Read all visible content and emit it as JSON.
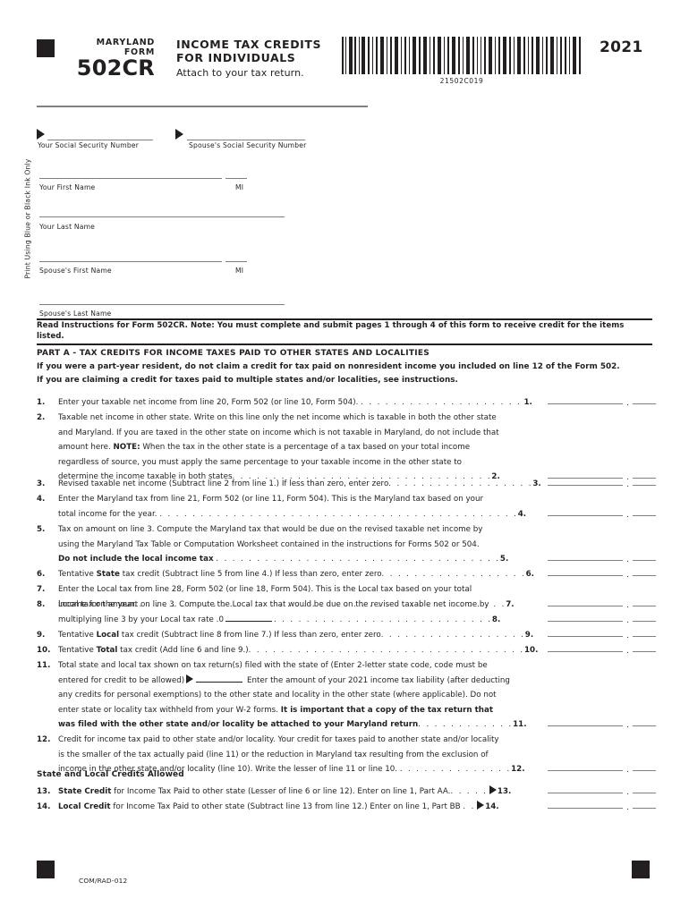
{
  "header": {
    "form_label_line1": "MARYLAND",
    "form_label_line2": "FORM",
    "form_number": "502CR",
    "title_line1": "INCOME TAX CREDITS",
    "title_line2": "FOR INDIVIDUALS",
    "subtitle": "Attach to your tax return.",
    "barcode_number": "21502C019",
    "year": "2021"
  },
  "sidebar": {
    "ink_note": "Print Using Blue or Black Ink Only"
  },
  "taxpayer_fields": [
    {
      "label": "Your Social Security Number",
      "value": ""
    },
    {
      "label": "Spouse's Social Security Number",
      "value": ""
    },
    {
      "label": "Your First Name",
      "value": ""
    },
    {
      "label": "MI",
      "value": ""
    },
    {
      "label": "Your Last Name",
      "value": ""
    },
    {
      "label": "Spouse's First Name",
      "value": ""
    },
    {
      "label": "MI",
      "value": ""
    },
    {
      "label": "Spouse's Last Name",
      "value": ""
    }
  ],
  "instructions": {
    "read_instructions": "Read Instructions for Form 502CR.  Note: You must complete and submit pages 1 through 4 of this form to receive credit for the items listed.",
    "part_heading": "PART A - TAX CREDITS FOR INCOME TAXES PAID TO OTHER STATES AND LOCALITIES",
    "note_a": "If you were a part-year resident, do not claim a credit for tax paid on nonresident income you included on line 12 of the Form 502.",
    "note_b": "If you are claiming a credit for taxes paid to multiple states and/or localities, see instructions."
  },
  "lines": {
    "l1": {
      "num": "1.",
      "text": "Enter your taxable net income from line 20, Form 502 (or line 10, Form 504).",
      "leader": ". . . . . . . . . . . . . . . . . . . .",
      "end": "1.",
      "value_dollars": "",
      "value_cents": ""
    },
    "l2": {
      "num": "2.",
      "t1": "Taxable net income in other state. Write on this line only the net income which is taxable in both the other state",
      "t2": "and Maryland. If you are taxed in the other state on income which is not taxable in Maryland, do not include that",
      "t3a": "amount here.  ",
      "t3b": "NOTE:",
      "t3c": " When the tax in the other state is a percentage of a tax based on your total income",
      "t4": "regardless of source, you must apply the same percentage to your taxable income in the other state to",
      "t5": "determine the income taxable in both states",
      "leader": ". . . . . . . . . . . . . . . . . . . . . . . . . . . . . . . .",
      "end": "2.",
      "value_dollars": "",
      "value_cents": ""
    },
    "l3": {
      "num": "3.",
      "text": "Revised taxable net income (Subtract line 2 from line 1.) If less than zero, enter zero",
      "leader": ". . . . . . . . . . . . . . . . . .",
      "end": "3.",
      "value_dollars": "",
      "value_cents": ""
    },
    "l4": {
      "num": "4.",
      "t1": "Enter the Maryland tax from line 21, Form 502 (or line 11, Form 504). This is the Maryland tax based on your",
      "t2": "total income for the year.",
      "leader": ". . . . . . . . . . . . . . . . . . . . . . . . . . . . . . . . . . . . . . . . . . . .",
      "end": "4.",
      "value_dollars": "",
      "value_cents": ""
    },
    "l5": {
      "num": "5.",
      "t1": "Tax on amount on line 3. Compute the Maryland tax that would be due on the revised taxable net income by",
      "t2": "using the Maryland Tax Table or Computation Worksheet contained in the instructions for Forms 502 or 504.",
      "t3": "Do not include the local income tax",
      "leader": ". . . . . . . . . . . . . . . . . . . . . . . . . . . . . . . . . . .",
      "end": "5.",
      "value_dollars": "",
      "value_cents": ""
    },
    "l6": {
      "num": "6.",
      "t1": "Tentative ",
      "t2": "State",
      "t3": " tax credit (Subtract line 5 from line 4.) If less than zero, enter zero",
      "leader": ". . . . . . . . . . . . . . . . . .",
      "end": "6.",
      "value_dollars": "",
      "value_cents": ""
    },
    "l7": {
      "num": "7.",
      "t1": "Enter the Local tax from line 28, Form 502 (or line 18, Form 504). This is the Local tax based on your total",
      "t2": "income for the year.",
      "leader": ". . . . . . . . . . . . . . . . . . . . . . . . . . . . . . . . . . . . . . . . . . . . .",
      "end": "7.",
      "value_dollars": "",
      "value_cents": ""
    },
    "l8": {
      "num": "8.",
      "t1": "Local tax on amount on line 3. Compute the Local tax that would be due on the revised taxable net income by",
      "t2": "multiplying line 3 by your Local tax rate",
      "rate_prefix": ".0",
      "rate_value": "",
      "leader": ". . . . . . . . . . . . . . . . . . . . . . . . . . .",
      "end": "8.",
      "value_dollars": "",
      "value_cents": ""
    },
    "l9": {
      "num": "9.",
      "t1": "Tentative ",
      "t2": "Local",
      "t3": " tax credit (Subtract line 8 from line 7.) If less than zero, enter zero",
      "leader": ". . . . . . . . . . . . . . . . . .",
      "end": "9.",
      "value_dollars": "",
      "value_cents": ""
    },
    "l10": {
      "num": "10.",
      "t1": "Tentative ",
      "t2": "Total",
      "t3": " tax credit (Add line 6 and line 9.)",
      "leader": ". . . . . . . . . . . . . . . . . . . . . . . . . . . . . . . . . .",
      "end": "10.",
      "value_dollars": "",
      "value_cents": ""
    },
    "l11": {
      "num": "11.",
      "t1": "Total state and local tax shown on tax return(s) filed with the state of (Enter 2-letter state code, code must be",
      "t2": "entered for credit to be allowed)",
      "state_code": "",
      "t3": "Enter the amount of your 2021 income tax liability (after deducting",
      "t4": "any credits for personal exemptions) to the other state and locality in the other state (where applicable). Do not",
      "t5a": "enter state or locality tax withheld from your W-2 forms. ",
      "t5b": "It is important that a copy of the tax return that",
      "t6": "was filed with the other state and/or locality be attached to your Maryland return",
      "leader": ". . . . . . . . . . . .",
      "end": "11.",
      "value_dollars": "",
      "value_cents": ""
    },
    "l12": {
      "num": "12.",
      "t1": "Credit for income tax paid to other state and/or locality. Your credit for taxes paid to another state and/or locality",
      "t2": "is the smaller of the tax actually paid (line 11) or the reduction in Maryland tax resulting from the exclusion of",
      "t3": "income in the other state and/or locality (line 10). Write the lesser of line 11 or line 10.",
      "leader": ". . . . . . . . . . . . . .",
      "end": "12.",
      "value_dollars": "",
      "value_cents": ""
    },
    "subhead": "State and Local Credits Allowed",
    "l13": {
      "num": "13.",
      "t1": "State Credit",
      "t2": " for Income Tax Paid to other state (Lesser of line 6 or line 12). Enter on line 1, Part AA.",
      "leader": ". . . . .",
      "end": "13.",
      "value_dollars": "",
      "value_cents": ""
    },
    "l14": {
      "num": "14.",
      "t1": "Local Credit",
      "t2": " for Income Tax Paid to other state (Subtract line 13 from line 12.) Enter on line 1, Part BB",
      "leader": ". .",
      "end": "14.",
      "value_dollars": "",
      "value_cents": ""
    }
  },
  "footer": {
    "code": "COM/RAD-012"
  },
  "colors": {
    "ink": "#231f20",
    "rule": "#808080"
  }
}
